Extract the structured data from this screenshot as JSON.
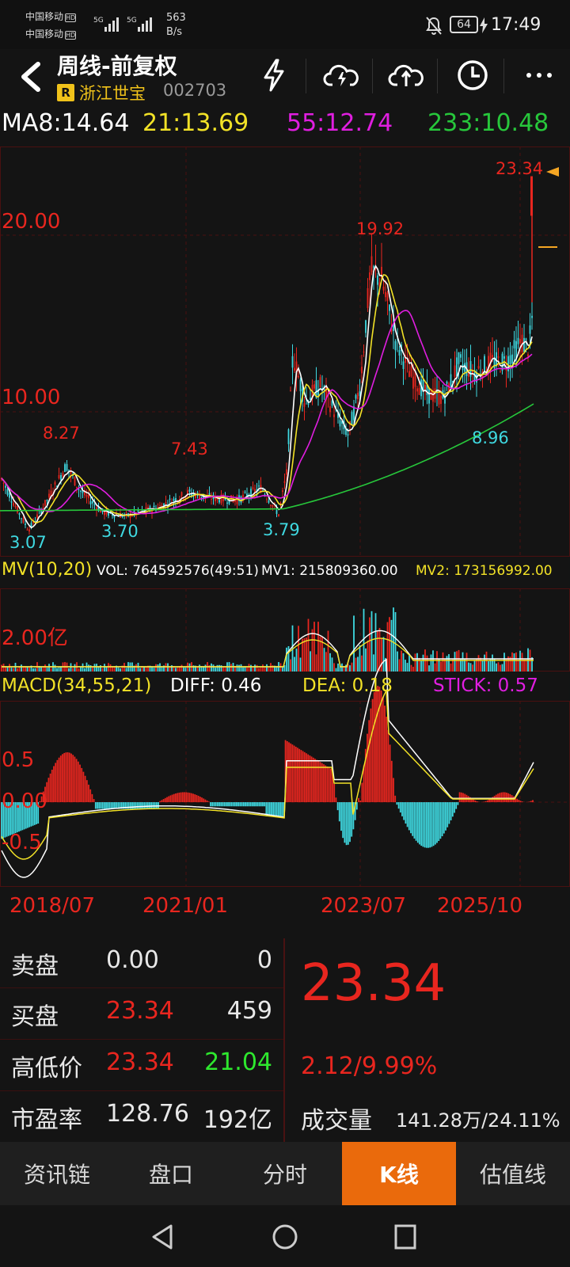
{
  "status": {
    "carrier1": "中国移动",
    "carrier2": "中国移动",
    "hd": "HD",
    "net_label": "5G",
    "net_speed_value": "563",
    "net_speed_unit": "B/s",
    "battery": "64",
    "time": "17:49"
  },
  "header": {
    "title": "周线-前复权",
    "badge": "R",
    "stock_name": "浙江世宝",
    "stock_code": "002703",
    "icons": [
      "back-icon",
      "lightning-icon",
      "cloud-download-icon",
      "cloud-upload-icon",
      "clock-icon",
      "more-icon"
    ]
  },
  "ma": {
    "ma8": "MA8:14.64",
    "ma21": "21:13.69",
    "ma55": "55:12.74",
    "ma233": "233:10.48"
  },
  "colors": {
    "up": "#e8261f",
    "down": "#3fd9e1",
    "ma8": "#ffffff",
    "ma21": "#f2e227",
    "ma55": "#e01ee0",
    "ma233": "#27c73b",
    "accent": "#ea6a0c"
  },
  "price_chart": {
    "axis_labels": [
      "20.00",
      "10.00"
    ],
    "high_labels": [
      "8.27",
      "7.43",
      "19.92",
      "23.34"
    ],
    "low_labels": [
      "3.07",
      "3.70",
      "3.79",
      "8.96"
    ]
  },
  "volume": {
    "title": "MV(10,20)",
    "vol": "VOL: 764592576(49:51)",
    "mv1": "MV1: 215809360.00",
    "mv2": "MV2: 173156992.00",
    "axis_label": "2.00亿"
  },
  "macd": {
    "title": "MACD(34,55,21)",
    "diff": "DIFF: 0.46",
    "dea": "DEA: 0.18",
    "stick": "STICK: 0.57",
    "axis_labels": [
      "0.5",
      "0.00",
      "-0.5"
    ]
  },
  "x_axis": [
    "2018/07",
    "2021/01",
    "2023/07",
    "2025/10"
  ],
  "quote": {
    "rows": [
      {
        "label": "卖盘",
        "v1": "0.00",
        "v2": "0"
      },
      {
        "label": "买盘",
        "v1": "23.34",
        "v2": "459"
      },
      {
        "label": "高低价",
        "v1": "23.34",
        "v2": "21.04"
      },
      {
        "label": "市盈率",
        "v1": "128.76",
        "v2": "192亿"
      }
    ],
    "price": "23.34",
    "change": "2.12/9.99%",
    "volume_label": "成交量",
    "volume_value": "141.28万/24.11%"
  },
  "tabs": [
    "资讯链",
    "盘口",
    "分时",
    "K线",
    "估值线"
  ],
  "active_tab": 3
}
